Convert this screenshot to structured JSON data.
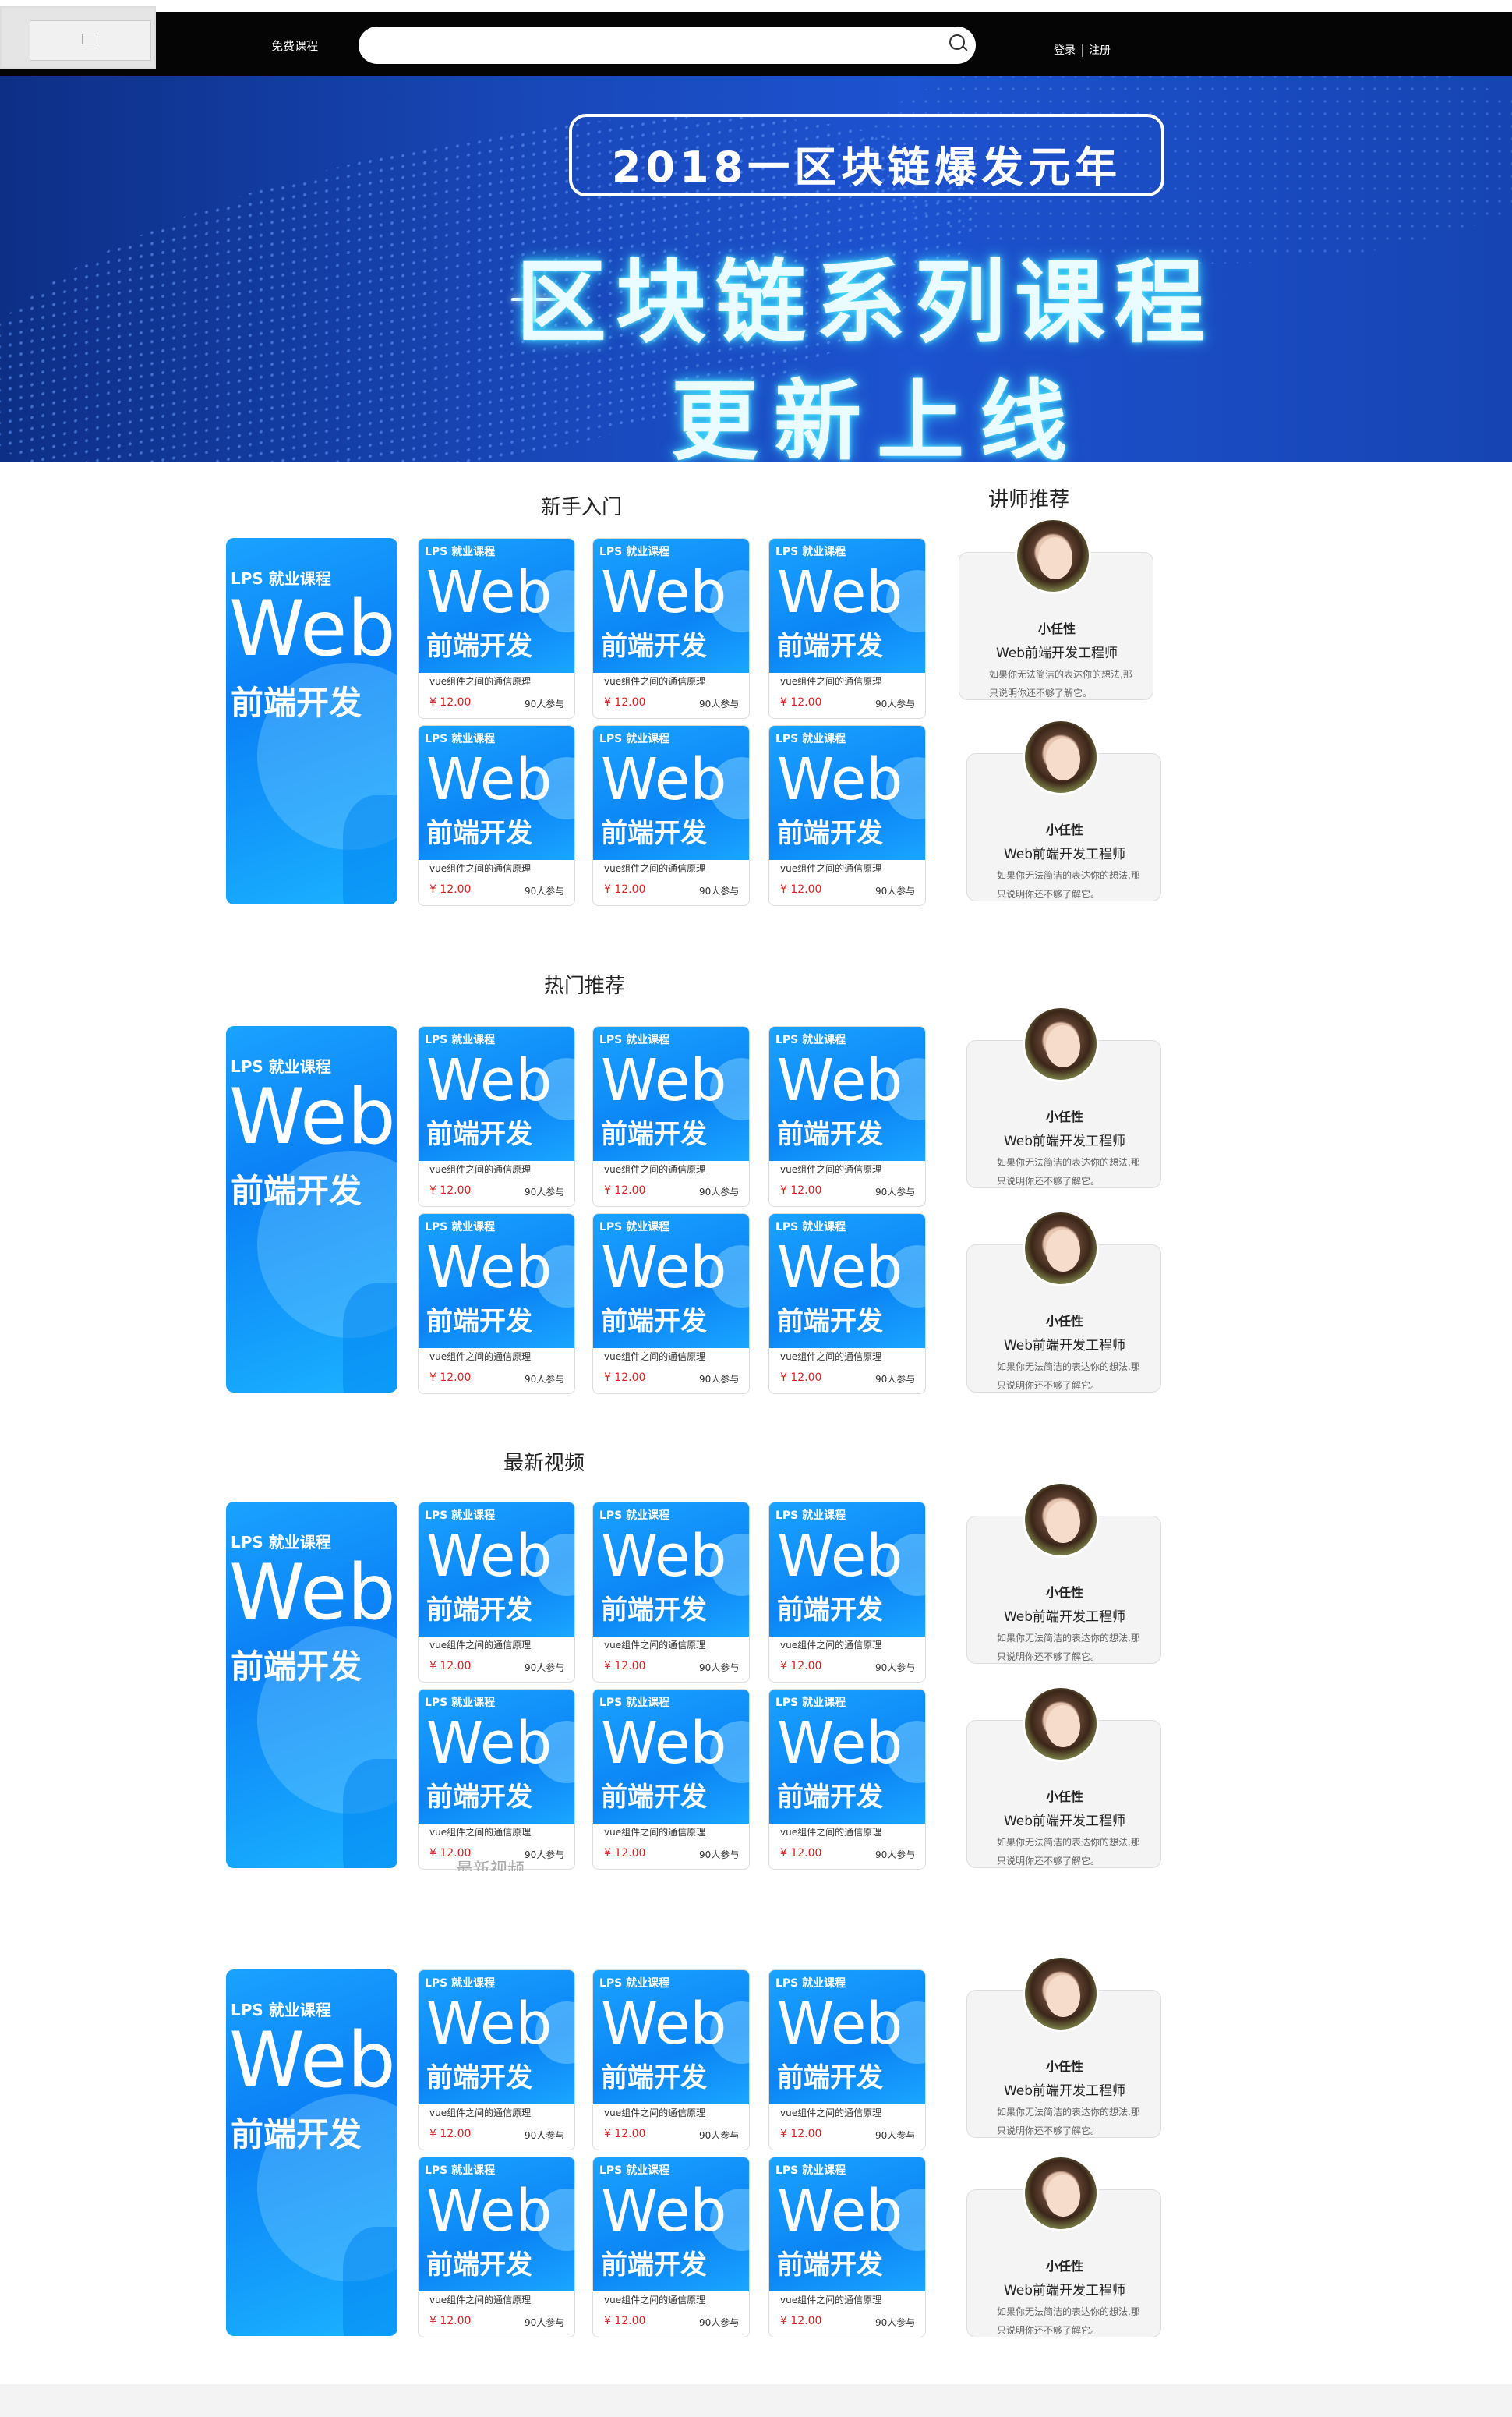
{
  "header": {
    "nav_label": "免费课程",
    "search_placeholder": "",
    "login": "登录",
    "register": "注册"
  },
  "banner": {
    "pill_text": "2018一区块链爆发元年",
    "title": "区块链系列课程",
    "subtitle": "更新上线"
  },
  "sections": [
    {
      "title": "新手入门"
    },
    {
      "title": "热门推荐"
    },
    {
      "title": "最新视频"
    },
    {
      "title": ""
    }
  ],
  "teacher_heading": "讲师推荐",
  "course": {
    "tag": "LPS 就业课程",
    "web": "Web",
    "fe": "前端开发",
    "desc": "vue组件之间的通信原理",
    "price": "¥ 12.00",
    "join": "90人参与"
  },
  "teacher": {
    "name": "小任性",
    "title": "Web前端开发工程师",
    "desc": "如果你无法简洁的表达你的想法,那只说明你还不够了解它。"
  },
  "colors": {
    "accent": "#0b84f6",
    "price": "#e02020",
    "topbar": "#050505"
  },
  "icons": [
    "menu-icon",
    "search-icon",
    "image-placeholder-icon"
  ]
}
